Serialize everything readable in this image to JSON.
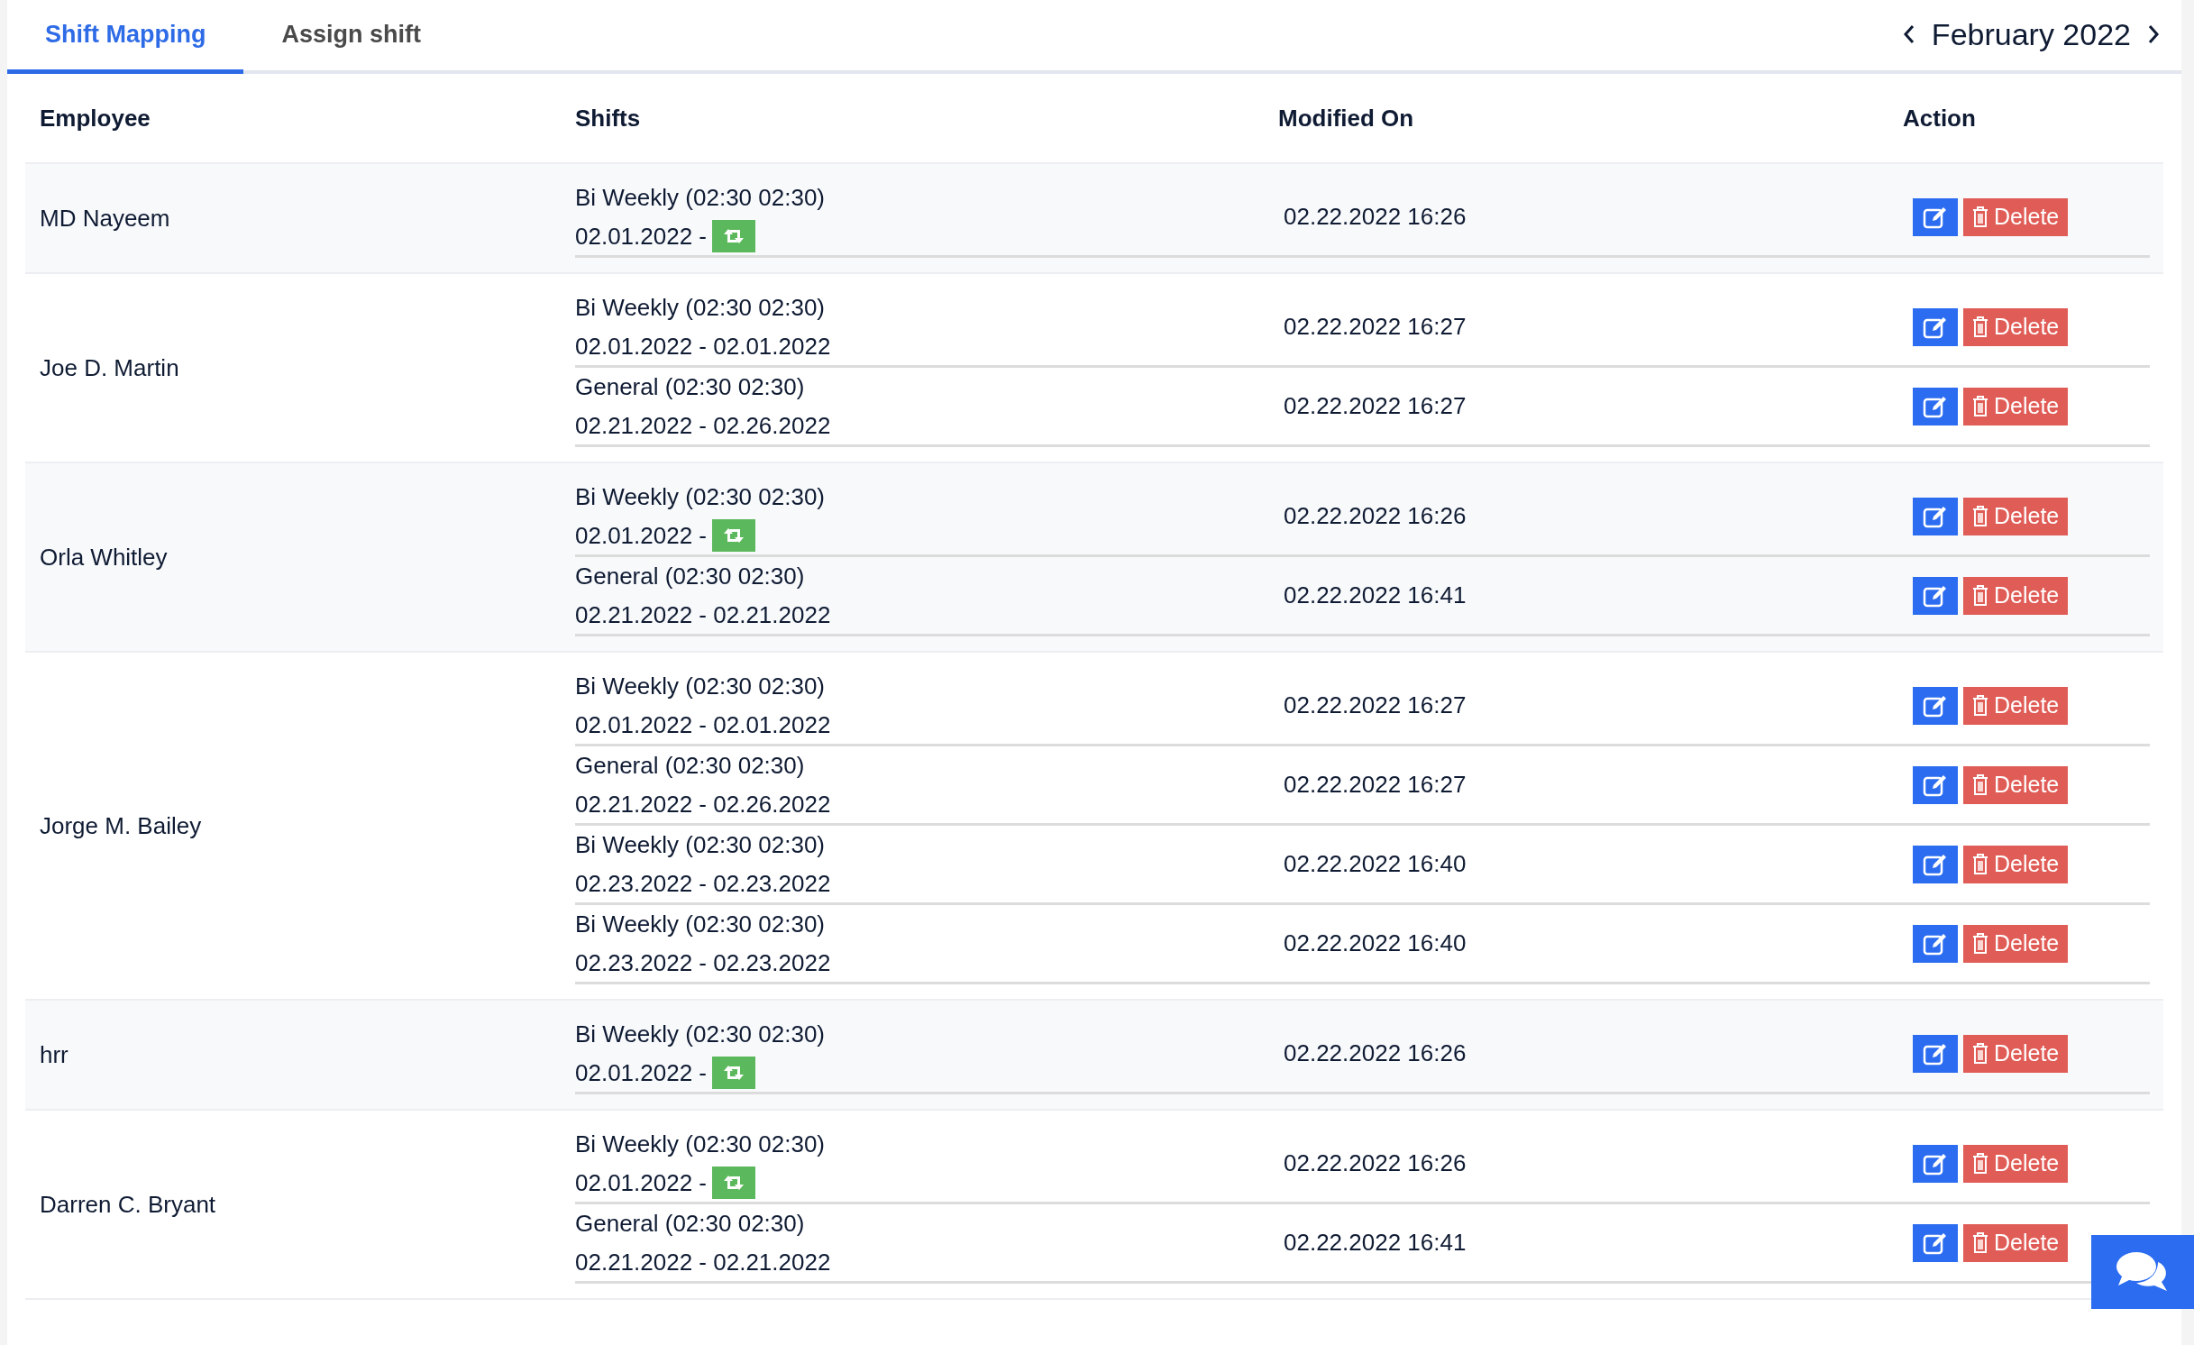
{
  "tabs": [
    {
      "label": "Shift Mapping",
      "selected": true
    },
    {
      "label": "Assign shift",
      "selected": false
    }
  ],
  "month_nav": {
    "label": "February 2022"
  },
  "table": {
    "columns": [
      "Employee",
      "Shifts",
      "Modified On",
      "Action"
    ],
    "rows": [
      {
        "employee": "MD Nayeem",
        "shifts": [
          {
            "name": "Bi Weekly (02:30 02:30)",
            "dates": "02.01.2022 -",
            "repeating": true,
            "modified_on": "02.22.2022 16:26",
            "delete_label": "Delete"
          }
        ]
      },
      {
        "employee": "Joe D. Martin",
        "shifts": [
          {
            "name": "Bi Weekly (02:30 02:30)",
            "dates": "02.01.2022 - 02.01.2022",
            "repeating": false,
            "modified_on": "02.22.2022 16:27",
            "delete_label": "Delete"
          },
          {
            "name": "General (02:30 02:30)",
            "dates": "02.21.2022 - 02.26.2022",
            "repeating": false,
            "modified_on": "02.22.2022 16:27",
            "delete_label": "Delete"
          }
        ]
      },
      {
        "employee": "Orla Whitley",
        "shifts": [
          {
            "name": "Bi Weekly (02:30 02:30)",
            "dates": "02.01.2022 -",
            "repeating": true,
            "modified_on": "02.22.2022 16:26",
            "delete_label": "Delete"
          },
          {
            "name": "General (02:30 02:30)",
            "dates": "02.21.2022 - 02.21.2022",
            "repeating": false,
            "modified_on": "02.22.2022 16:41",
            "delete_label": "Delete"
          }
        ]
      },
      {
        "employee": "Jorge M. Bailey",
        "shifts": [
          {
            "name": "Bi Weekly (02:30 02:30)",
            "dates": "02.01.2022 - 02.01.2022",
            "repeating": false,
            "modified_on": "02.22.2022 16:27",
            "delete_label": "Delete"
          },
          {
            "name": "General (02:30 02:30)",
            "dates": "02.21.2022 - 02.26.2022",
            "repeating": false,
            "modified_on": "02.22.2022 16:27",
            "delete_label": "Delete"
          },
          {
            "name": "Bi Weekly (02:30 02:30)",
            "dates": "02.23.2022 - 02.23.2022",
            "repeating": false,
            "modified_on": "02.22.2022 16:40",
            "delete_label": "Delete"
          },
          {
            "name": "Bi Weekly (02:30 02:30)",
            "dates": "02.23.2022 - 02.23.2022",
            "repeating": false,
            "modified_on": "02.22.2022 16:40",
            "delete_label": "Delete"
          }
        ]
      },
      {
        "employee": "hrr",
        "shifts": [
          {
            "name": "Bi Weekly (02:30 02:30)",
            "dates": "02.01.2022 -",
            "repeating": true,
            "modified_on": "02.22.2022 16:26",
            "delete_label": "Delete"
          }
        ]
      },
      {
        "employee": "Darren C. Bryant",
        "shifts": [
          {
            "name": "Bi Weekly (02:30 02:30)",
            "dates": "02.01.2022 -",
            "repeating": true,
            "modified_on": "02.22.2022 16:26",
            "delete_label": "Delete"
          },
          {
            "name": "General (02:30 02:30)",
            "dates": "02.21.2022 - 02.21.2022",
            "repeating": false,
            "modified_on": "02.22.2022 16:41",
            "delete_label": "Delete"
          }
        ]
      }
    ]
  }
}
